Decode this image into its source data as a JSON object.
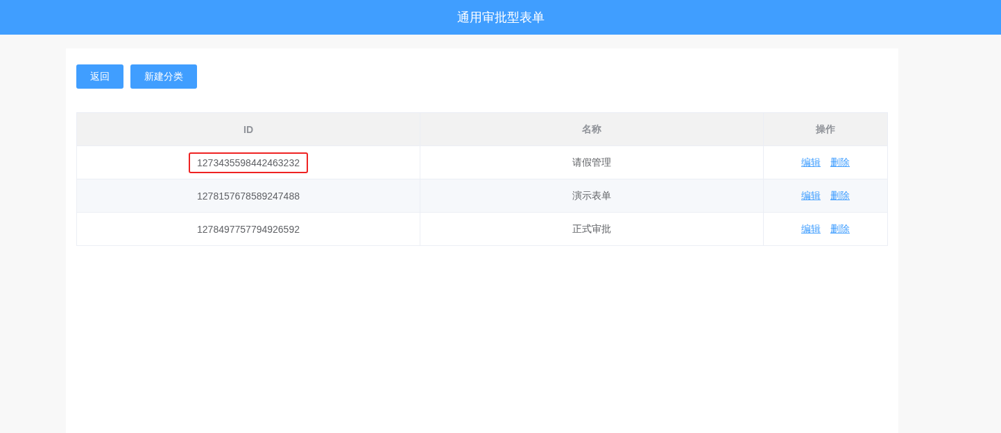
{
  "header": {
    "title": "通用审批型表单"
  },
  "buttons": [
    "返回",
    "新建分类"
  ],
  "table": {
    "columns": [
      "ID",
      "名称",
      "操作"
    ],
    "rows": [
      {
        "id": "1273435598442463232",
        "name": "请假管理",
        "highlighted": true,
        "actions": [
          "编辑",
          "删除"
        ]
      },
      {
        "id": "1278157678589247488",
        "name": "演示表单",
        "highlighted": false,
        "actions": [
          "编辑",
          "删除"
        ]
      },
      {
        "id": "1278497757794926592",
        "name": "正式审批",
        "highlighted": false,
        "actions": [
          "编辑",
          "删除"
        ]
      }
    ]
  }
}
